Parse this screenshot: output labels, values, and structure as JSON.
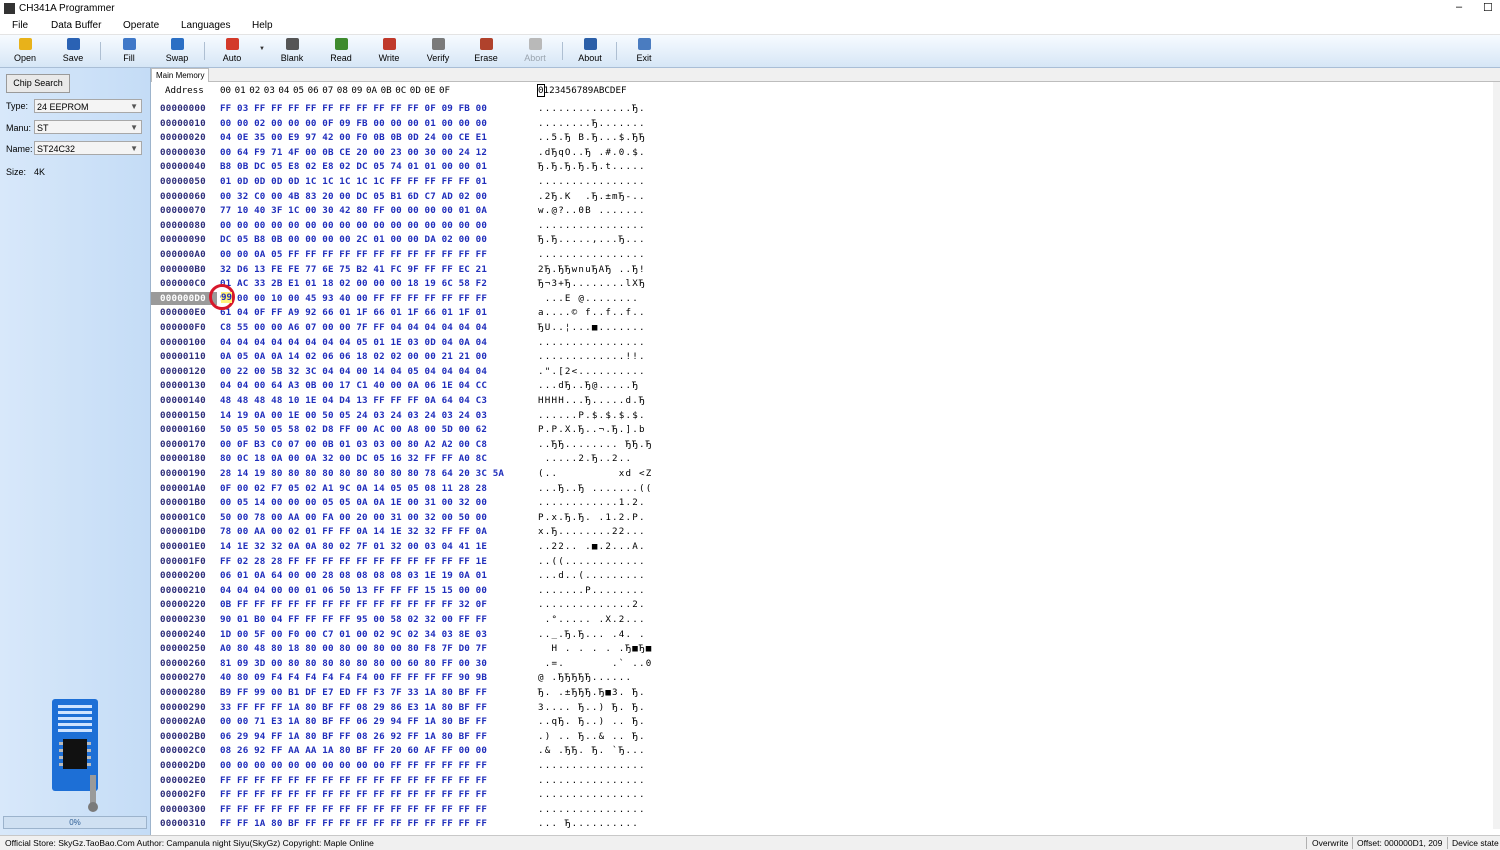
{
  "window": {
    "title": "CH341A Programmer",
    "min_glyph": "–",
    "max_glyph": "☐"
  },
  "menu": [
    "File",
    "Data Buffer",
    "Operate",
    "Languages",
    "Help"
  ],
  "toolbar": [
    {
      "label": "Open",
      "icon": "folder-open-icon",
      "color": "#e8b21a",
      "enabled": true
    },
    {
      "label": "Save",
      "icon": "floppy-save-icon",
      "color": "#2a62b4",
      "enabled": true
    },
    {
      "label": "Fill",
      "icon": "fill-buffer-icon",
      "color": "#3f78c8",
      "enabled": true
    },
    {
      "label": "Swap",
      "icon": "swap-arrows-icon",
      "color": "#2b6fc4",
      "enabled": true
    },
    {
      "label": "Auto",
      "icon": "auto-program-icon",
      "color": "#d33a2a",
      "enabled": true
    },
    {
      "label": "Blank",
      "icon": "blank-check-icon",
      "color": "#555555",
      "enabled": true
    },
    {
      "label": "Read",
      "icon": "read-chip-icon",
      "color": "#3e8a2e",
      "enabled": true
    },
    {
      "label": "Write",
      "icon": "write-chip-icon",
      "color": "#c0392b",
      "enabled": true
    },
    {
      "label": "Verify",
      "icon": "verify-chip-icon",
      "color": "#7a7a7a",
      "enabled": true
    },
    {
      "label": "Erase",
      "icon": "erase-chip-icon",
      "color": "#b0422c",
      "enabled": true
    },
    {
      "label": "Abort",
      "icon": "abort-icon",
      "color": "#b9b9b9",
      "enabled": false
    },
    {
      "label": "About",
      "icon": "info-icon",
      "color": "#2b5fa8",
      "enabled": true
    },
    {
      "label": "Exit",
      "icon": "exit-icon",
      "color": "#4a7cc0",
      "enabled": true
    }
  ],
  "left_panel": {
    "chip_search_label": "Chip Search",
    "type_label": "Type:",
    "type_value": "24 EEPROM",
    "manu_label": "Manu:",
    "manu_value": "ST",
    "name_label": "Name:",
    "name_value": "ST24C32",
    "size_label": "Size:",
    "size_value": "4K",
    "progress_text": "0%",
    "progress_fraction": 0.0
  },
  "tab": "Main Memory",
  "hex_header": {
    "address_label": "Address",
    "columns": [
      "00",
      "01",
      "02",
      "03",
      "04",
      "05",
      "06",
      "07",
      "08",
      "09",
      "0A",
      "0B",
      "0C",
      "0D",
      "0E",
      "0F"
    ],
    "ascii_label": "0123456789ABCDEF"
  },
  "hex_rows": [
    {
      "addr": "00000000",
      "hex": "FF 03 FF FF FF FF FF FF FF FF FF FF 0F 09 FB 00",
      "ascii": "..............Ђ."
    },
    {
      "addr": "00000010",
      "hex": "00 00 02 00 00 00 0F 09 FB 00 00 00 01 00 00 00",
      "ascii": "........Ђ......."
    },
    {
      "addr": "00000020",
      "hex": "04 0E 35 00 E9 97 42 00 F0 0B 0B 0D 24 00 CE E1",
      "ascii": "..5.Ђ B.Ђ...$.ЂЂ"
    },
    {
      "addr": "00000030",
      "hex": "00 64 F9 71 4F 00 0B CE 20 00 23 00 30 00 24 12",
      "ascii": ".dЂqO..Ђ .#.0.$."
    },
    {
      "addr": "00000040",
      "hex": "B8 0B DC 05 E8 02 E8 02 DC 05 74 01 01 00 00 01",
      "ascii": "Ђ.Ђ.Ђ.Ђ.Ђ.t....."
    },
    {
      "addr": "00000050",
      "hex": "01 0D 0D 0D 0D 1C 1C 1C 1C 1C FF FF FF FF FF 01",
      "ascii": "................"
    },
    {
      "addr": "00000060",
      "hex": "00 32 C0 00 4B 83 20 00 DC 05 B1 6D C7 AD 02 00",
      "ascii": ".2Ђ.K  .Ђ.±mЂ-.."
    },
    {
      "addr": "00000070",
      "hex": "77 10 40 3F 1C 00 30 42 80 FF 00 00 00 00 01 0A",
      "ascii": "w.@?..0B ......."
    },
    {
      "addr": "00000080",
      "hex": "00 00 00 00 00 00 00 00 00 00 00 00 00 00 00 00",
      "ascii": "................"
    },
    {
      "addr": "00000090",
      "hex": "DC 05 B8 0B 00 00 00 00 2C 01 00 00 DA 02 00 00",
      "ascii": "Ђ.Ђ.....,...Ђ..."
    },
    {
      "addr": "000000A0",
      "hex": "00 00 0A 05 FF FF FF FF FF FF FF FF FF FF FF FF",
      "ascii": "................"
    },
    {
      "addr": "000000B0",
      "hex": "32 D6 13 FE FE 77 6E 75 B2 41 FC 9F FF FF EC 21",
      "ascii": "2Ђ.ЂЂwnuЂAЂ ..Ђ!"
    },
    {
      "addr": "000000C0",
      "hex": "01 AC 33 2B E1 01 18 02 00 00 00 18 19 6C 58 F2",
      "ascii": "Ђ¬3+Ђ........lXЂ"
    },
    {
      "addr": "000000D0",
      "hex": "99 00 00 10 00 45 93 40 00 FF FF FF FF FF FF FF",
      "ascii": " ...E @........"
    },
    {
      "addr": "000000E0",
      "hex": "61 04 0F FF A9 92 66 01 1F 66 01 1F 66 01 1F 01",
      "ascii": "a....© f..f..f.."
    },
    {
      "addr": "000000F0",
      "hex": "C8 55 00 00 A6 07 00 00 7F FF 04 04 04 04 04 04",
      "ascii": "ЂU..¦...■......."
    },
    {
      "addr": "00000100",
      "hex": "04 04 04 04 04 04 04 04 05 01 1E 03 0D 04 0A 04",
      "ascii": "................"
    },
    {
      "addr": "00000110",
      "hex": "0A 05 0A 0A 14 02 06 06 18 02 02 00 00 21 21 00",
      "ascii": ".............!!."
    },
    {
      "addr": "00000120",
      "hex": "00 22 00 5B 32 3C 04 04 00 14 04 05 04 04 04 04",
      "ascii": ".\".[2<.........."
    },
    {
      "addr": "00000130",
      "hex": "04 04 00 64 A3 0B 00 17 C1 40 00 0A 06 1E 04 CC",
      "ascii": "...dЂ..Ђ@.....Ђ"
    },
    {
      "addr": "00000140",
      "hex": "48 48 48 48 10 1E 04 D4 13 FF FF FF 0A 64 04 C3",
      "ascii": "HHHH...Ђ.....d.Ђ"
    },
    {
      "addr": "00000150",
      "hex": "14 19 0A 00 1E 00 50 05 24 03 24 03 24 03 24 03",
      "ascii": "......P.$.$.$.$."
    },
    {
      "addr": "00000160",
      "hex": "50 05 50 05 58 02 D8 FF 00 AC 00 A8 00 5D 00 62",
      "ascii": "P.P.X.Ђ..¬.Ђ.].b"
    },
    {
      "addr": "00000170",
      "hex": "00 0F B3 C0 07 00 0B 01 03 03 00 80 A2 A2 00 C8",
      "ascii": "..ЂЂ........ ЂЂ.Ђ"
    },
    {
      "addr": "00000180",
      "hex": "80 0C 18 0A 00 0A 32 00 DC 05 16 32 FF FF A0 8C",
      "ascii": " .....2.Ђ..2.."
    },
    {
      "addr": "00000190",
      "hex": "28 14 19 80 80 80 80 80 80 80 80 80 78 64 20 3C 5A",
      "ascii": "(..         xd <Z"
    },
    {
      "addr": "000001A0",
      "hex": "0F 00 02 F7 05 02 A1 9C 0A 14 05 05 08 11 28 28",
      "ascii": "...Ђ..Ђ .......(("
    },
    {
      "addr": "000001B0",
      "hex": "00 05 14 00 00 00 05 05 0A 0A 1E 00 31 00 32 00",
      "ascii": "............1.2."
    },
    {
      "addr": "000001C0",
      "hex": "50 00 78 00 AA 00 FA 00 20 00 31 00 32 00 50 00",
      "ascii": "P.x.Ђ.Ђ. .1.2.P."
    },
    {
      "addr": "000001D0",
      "hex": "78 00 AA 00 02 01 FF FF 0A 14 1E 32 32 FF FF 0A",
      "ascii": "x.Ђ........22..."
    },
    {
      "addr": "000001E0",
      "hex": "14 1E 32 32 0A 0A 80 02 7F 01 32 00 03 04 41 1E",
      "ascii": "..22.. .■.2...A."
    },
    {
      "addr": "000001F0",
      "hex": "FF 02 28 28 FF FF FF FF FF FF FF FF FF FF FF 1E",
      "ascii": "..((............"
    },
    {
      "addr": "00000200",
      "hex": "06 01 0A 64 00 00 28 08 08 08 08 03 1E 19 0A 01",
      "ascii": "...d..(........."
    },
    {
      "addr": "00000210",
      "hex": "04 04 04 00 00 01 06 50 13 FF FF FF 15 15 00 00",
      "ascii": ".......P........"
    },
    {
      "addr": "00000220",
      "hex": "0B FF FF FF FF FF FF FF FF FF FF FF FF FF 32 0F",
      "ascii": "..............2."
    },
    {
      "addr": "00000230",
      "hex": "90 01 B0 04 FF FF FF FF 95 00 58 02 32 00 FF FF",
      "ascii": " .°..... .X.2..."
    },
    {
      "addr": "00000240",
      "hex": "1D 00 5F 00 F0 00 C7 01 00 02 9C 02 34 03 8E 03",
      "ascii": ".._.Ђ.Ђ... .4. ."
    },
    {
      "addr": "00000250",
      "hex": "A0 80 48 80 18 80 00 80 00 80 00 80 F8 7F D0 7F",
      "ascii": "  H . . . . .Ђ■Ђ■"
    },
    {
      "addr": "00000260",
      "hex": "81 09 3D 00 80 80 80 80 80 80 00 60 80 FF 00 30",
      "ascii": " .=.       .` ..0"
    },
    {
      "addr": "00000270",
      "hex": "40 80 09 F4 F4 F4 F4 F4 F4 00 FF FF FF FF 90 9B",
      "ascii": "@ .ЂЂЂЂЂ......"
    },
    {
      "addr": "00000280",
      "hex": "B9 FF 99 00 B1 DF E7 ED FF F3 7F 33 1A 80 BF FF",
      "ascii": "Ђ. .±ЂЂЂ.Ђ■3. Ђ."
    },
    {
      "addr": "00000290",
      "hex": "33 FF FF FF 1A 80 BF FF 08 29 86 E3 1A 80 BF FF",
      "ascii": "3.... Ђ..) Ђ. Ђ."
    },
    {
      "addr": "000002A0",
      "hex": "00 00 71 E3 1A 80 BF FF 06 29 94 FF 1A 80 BF FF",
      "ascii": "..qЂ. Ђ..) .. Ђ."
    },
    {
      "addr": "000002B0",
      "hex": "06 29 94 FF 1A 80 BF FF 08 26 92 FF 1A 80 BF FF",
      "ascii": ".) .. Ђ..& .. Ђ."
    },
    {
      "addr": "000002C0",
      "hex": "08 26 92 FF AA AA 1A 80 BF FF 20 60 AF FF 00 00",
      "ascii": ".& .ЂЂ. Ђ. `Ђ..."
    },
    {
      "addr": "000002D0",
      "hex": "00 00 00 00 00 00 00 00 00 00 FF FF FF FF FF FF",
      "ascii": "................"
    },
    {
      "addr": "000002E0",
      "hex": "FF FF FF FF FF FF FF FF FF FF FF FF FF FF FF FF",
      "ascii": "................"
    },
    {
      "addr": "000002F0",
      "hex": "FF FF FF FF FF FF FF FF FF FF FF FF FF FF FF FF",
      "ascii": "................"
    },
    {
      "addr": "00000300",
      "hex": "FF FF FF FF FF FF FF FF FF FF FF FF FF FF FF FF",
      "ascii": "................"
    },
    {
      "addr": "00000310",
      "hex": "FF FF 1A 80 BF FF FF FF FF FF FF FF FF FF FF FF",
      "ascii": "... Ђ.........."
    }
  ],
  "selection": {
    "row_addr": "000000D0",
    "value": "99"
  },
  "status": {
    "left": "Official Store: SkyGz.TaoBao.Com Author: Campanula night Siyu(SkyGz) Copyright: Maple Online",
    "mode": "Overwrite",
    "offset": "Offset: 000000D1, 209",
    "device": "Device state"
  },
  "colors": {
    "accent": "#1f2dbb",
    "marker": "#d8172a",
    "panel": "#d8e8fa"
  }
}
